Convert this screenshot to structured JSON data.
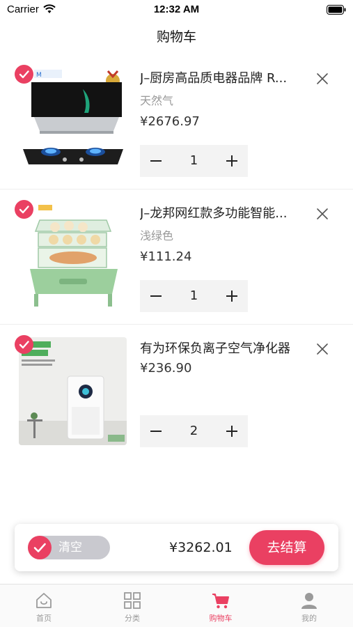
{
  "status_bar": {
    "carrier": "Carrier",
    "time": "12:32 AM"
  },
  "nav": {
    "title": "购物车"
  },
  "cart": {
    "items": [
      {
        "title": "J–厨房高品质电器品牌 R...",
        "spec": "天然气",
        "price": "¥2676.97",
        "quantity": "1",
        "checked": true
      },
      {
        "title": "J–龙邦网红款多功能智能...",
        "spec": "浅绿色",
        "price": "¥111.24",
        "quantity": "1",
        "checked": true
      },
      {
        "title": "有为环保负离子空气净化器",
        "spec": "",
        "price": "¥236.90",
        "quantity": "2",
        "checked": true
      }
    ]
  },
  "footer": {
    "clear_label": "清空",
    "total": "¥3262.01",
    "checkout_label": "去结算"
  },
  "tabs": [
    {
      "label": "首页",
      "icon": "home-icon",
      "active": false
    },
    {
      "label": "分类",
      "icon": "category-grid-icon",
      "active": false
    },
    {
      "label": "购物车",
      "icon": "cart-icon",
      "active": true
    },
    {
      "label": "我的",
      "icon": "user-icon",
      "active": false
    }
  ],
  "colors": {
    "accent": "#ea4062",
    "muted": "#999999",
    "pill": "#c9c9cf"
  }
}
